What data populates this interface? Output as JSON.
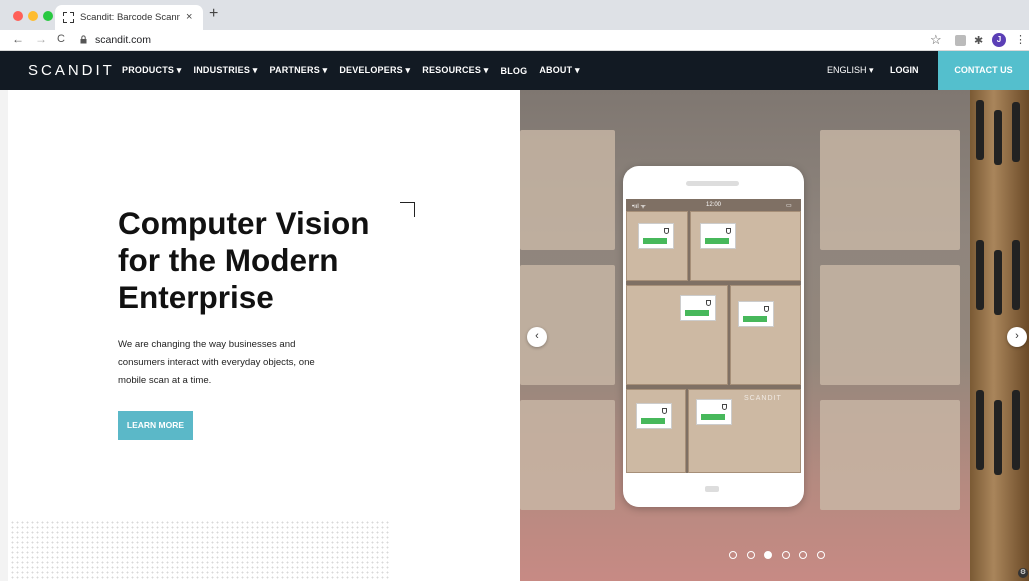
{
  "browser": {
    "tab_title": "Scandit: Barcode Scanning So",
    "tab_close": "×",
    "new_tab": "+",
    "back": "←",
    "forward": "→",
    "reload": "C",
    "url": "scandit.com",
    "star": "☆",
    "puzzle": "✱",
    "menu": "⋮",
    "avatar_letter": "J"
  },
  "site": {
    "logo": "SCANDIT",
    "menu": [
      {
        "label": "PRODUCTS ▾"
      },
      {
        "label": "INDUSTRIES ▾"
      },
      {
        "label": "PARTNERS ▾"
      },
      {
        "label": "DEVELOPERS ▾"
      },
      {
        "label": "RESOURCES ▾"
      },
      {
        "label": "BLOG"
      },
      {
        "label": "ABOUT ▾"
      }
    ],
    "language": "ENGLISH ▾",
    "login": "LOGIN",
    "contact": "CONTACT US",
    "accent_color": "#54bfcd",
    "nav_bg": "#121a23"
  },
  "hero": {
    "title": "Computer Vision for the Modern Enterprise",
    "subtitle": "We are changing the way businesses and consumers interact with everyday objects, one mobile scan at a time.",
    "cta": "LEARN MORE"
  },
  "slider": {
    "prev": "‹",
    "next": "›",
    "phone_time": "12:00",
    "phone_signal": "•ııl ᯤ",
    "phone_battery": "▭",
    "scanner_brand": "SCANDIT",
    "dots": 6,
    "active_dot": 3
  }
}
